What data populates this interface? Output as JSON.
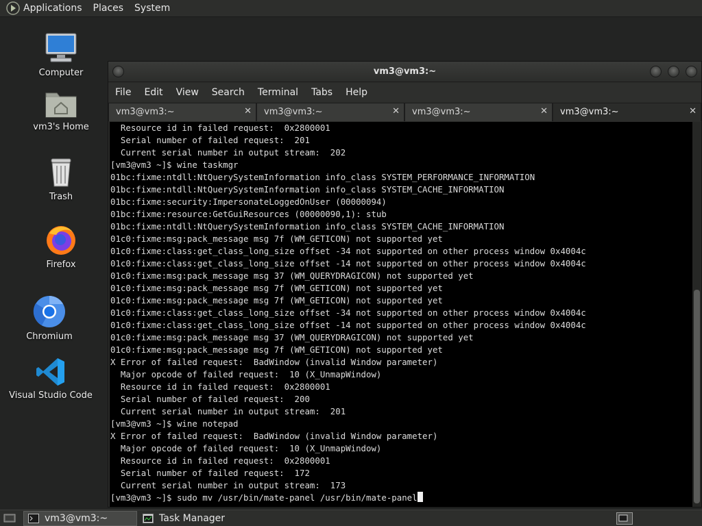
{
  "top_panel": {
    "menus": [
      "Applications",
      "Places",
      "System"
    ]
  },
  "desktop": {
    "icons": [
      {
        "label": "Computer"
      },
      {
        "label": "vm3's Home"
      },
      {
        "label": "Trash"
      },
      {
        "label": "Firefox"
      },
      {
        "label": "Chromium"
      },
      {
        "label": "Visual Studio Code"
      }
    ]
  },
  "terminal": {
    "title": "vm3@vm3:~",
    "menu": [
      "File",
      "Edit",
      "View",
      "Search",
      "Terminal",
      "Tabs",
      "Help"
    ],
    "tabs": [
      {
        "label": "vm3@vm3:~"
      },
      {
        "label": "vm3@vm3:~"
      },
      {
        "label": "vm3@vm3:~"
      },
      {
        "label": "vm3@vm3:~"
      }
    ],
    "lines": [
      "  Resource id in failed request:  0x2800001",
      "  Serial number of failed request:  201",
      "  Current serial number in output stream:  202",
      "[vm3@vm3 ~]$ wine taskmgr",
      "01bc:fixme:ntdll:NtQuerySystemInformation info_class SYSTEM_PERFORMANCE_INFORMATION",
      "01bc:fixme:ntdll:NtQuerySystemInformation info_class SYSTEM_CACHE_INFORMATION",
      "01bc:fixme:security:ImpersonateLoggedOnUser (00000094)",
      "01bc:fixme:resource:GetGuiResources (00000090,1): stub",
      "01bc:fixme:ntdll:NtQuerySystemInformation info_class SYSTEM_CACHE_INFORMATION",
      "01c0:fixme:msg:pack_message msg 7f (WM_GETICON) not supported yet",
      "01c0:fixme:class:get_class_long_size offset -34 not supported on other process window 0x4004c",
      "01c0:fixme:class:get_class_long_size offset -14 not supported on other process window 0x4004c",
      "01c0:fixme:msg:pack_message msg 37 (WM_QUERYDRAGICON) not supported yet",
      "01c0:fixme:msg:pack_message msg 7f (WM_GETICON) not supported yet",
      "01c0:fixme:msg:pack_message msg 7f (WM_GETICON) not supported yet",
      "01c0:fixme:class:get_class_long_size offset -34 not supported on other process window 0x4004c",
      "01c0:fixme:class:get_class_long_size offset -14 not supported on other process window 0x4004c",
      "01c0:fixme:msg:pack_message msg 37 (WM_QUERYDRAGICON) not supported yet",
      "01c0:fixme:msg:pack_message msg 7f (WM_GETICON) not supported yet",
      "X Error of failed request:  BadWindow (invalid Window parameter)",
      "  Major opcode of failed request:  10 (X_UnmapWindow)",
      "  Resource id in failed request:  0x2800001",
      "  Serial number of failed request:  200",
      "  Current serial number in output stream:  201",
      "[vm3@vm3 ~]$ wine notepad",
      "X Error of failed request:  BadWindow (invalid Window parameter)",
      "  Major opcode of failed request:  10 (X_UnmapWindow)",
      "  Resource id in failed request:  0x2800001",
      "  Serial number of failed request:  172",
      "  Current serial number in output stream:  173"
    ],
    "prompt_line": "[vm3@vm3 ~]$ sudo mv /usr/bin/mate-panel /usr/bin/mate-panel"
  },
  "taskbar": {
    "items": [
      {
        "label": "vm3@vm3:~",
        "active": true
      },
      {
        "label": "Task Manager",
        "active": false
      }
    ]
  }
}
